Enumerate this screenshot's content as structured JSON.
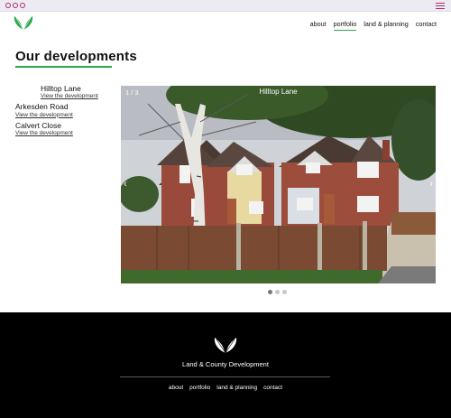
{
  "colors": {
    "accent": "#2ba84a",
    "chrome_icon": "#b02a6b",
    "footer_bg": "#000000"
  },
  "header": {
    "logo_icon": "leaf-logo-icon",
    "nav": [
      {
        "label": "about"
      },
      {
        "label": "portfolio",
        "active": true
      },
      {
        "label": "land & planning"
      },
      {
        "label": "contact"
      }
    ]
  },
  "main": {
    "title": "Our developments",
    "developments": [
      {
        "name": "Hilltop Lane",
        "link": "View the development",
        "active": true
      },
      {
        "name": "Arkesden Road",
        "link": "View the development"
      },
      {
        "name": "Calvert Close",
        "link": "View the development"
      }
    ]
  },
  "slider": {
    "counter": "1 / 3",
    "caption": "Hilltop Lane",
    "prev_icon": "chevron-left-icon",
    "next_icon": "chevron-right-icon",
    "dots": 3,
    "active_dot": 1
  },
  "footer": {
    "brand": "Land & County Development",
    "nav": [
      {
        "label": "about"
      },
      {
        "label": "portfolio"
      },
      {
        "label": "land & planning"
      },
      {
        "label": "contact"
      }
    ]
  }
}
